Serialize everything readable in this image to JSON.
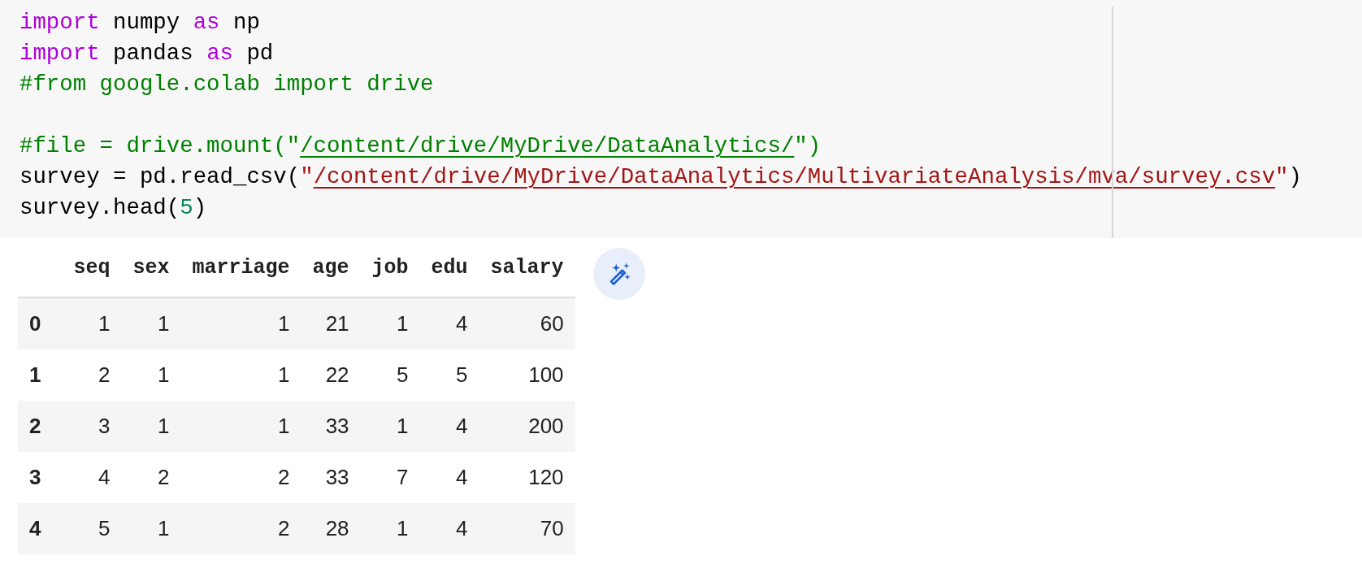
{
  "code_cell": {
    "lines": [
      {
        "kind": "code",
        "tokens": [
          {
            "kind": "keyword",
            "text": "import"
          },
          {
            "kind": "plain",
            "text": " numpy "
          },
          {
            "kind": "keyword",
            "text": "as"
          },
          {
            "kind": "plain",
            "text": " np"
          }
        ]
      },
      {
        "kind": "code",
        "tokens": [
          {
            "kind": "keyword",
            "text": "import"
          },
          {
            "kind": "plain",
            "text": " pandas "
          },
          {
            "kind": "keyword",
            "text": "as"
          },
          {
            "kind": "plain",
            "text": " pd"
          }
        ]
      },
      {
        "kind": "code",
        "tokens": [
          {
            "kind": "comment",
            "text": "#from google.colab import drive"
          }
        ]
      },
      {
        "kind": "blank"
      },
      {
        "kind": "code",
        "tokens": [
          {
            "kind": "comment",
            "text": "#file = drive.mount(\""
          },
          {
            "kind": "comment-link",
            "text": "/content/drive/MyDrive/DataAnalytics/"
          },
          {
            "kind": "comment",
            "text": "\")"
          }
        ]
      },
      {
        "kind": "code",
        "tokens": [
          {
            "kind": "plain",
            "text": "survey = pd.read_csv("
          },
          {
            "kind": "string",
            "text": "\""
          },
          {
            "kind": "string-link",
            "text": "/content/drive/MyDrive/DataAnalytics/MultivariateAnalysis/mva/survey.csv"
          },
          {
            "kind": "string",
            "text": "\""
          },
          {
            "kind": "plain",
            "text": ")"
          }
        ]
      },
      {
        "kind": "code",
        "tokens": [
          {
            "kind": "plain",
            "text": "survey.head("
          },
          {
            "kind": "number",
            "text": "5"
          },
          {
            "kind": "plain",
            "text": ")"
          }
        ]
      }
    ]
  },
  "output_table": {
    "columns": [
      "seq",
      "sex",
      "marriage",
      "age",
      "job",
      "edu",
      "salary"
    ],
    "rows": [
      {
        "index": "0",
        "cells": [
          "1",
          "1",
          "1",
          "21",
          "1",
          "4",
          "60"
        ]
      },
      {
        "index": "1",
        "cells": [
          "2",
          "1",
          "1",
          "22",
          "5",
          "5",
          "100"
        ]
      },
      {
        "index": "2",
        "cells": [
          "3",
          "1",
          "1",
          "33",
          "1",
          "4",
          "200"
        ]
      },
      {
        "index": "3",
        "cells": [
          "4",
          "2",
          "2",
          "33",
          "7",
          "4",
          "120"
        ]
      },
      {
        "index": "4",
        "cells": [
          "5",
          "1",
          "2",
          "28",
          "1",
          "4",
          "70"
        ]
      }
    ]
  }
}
